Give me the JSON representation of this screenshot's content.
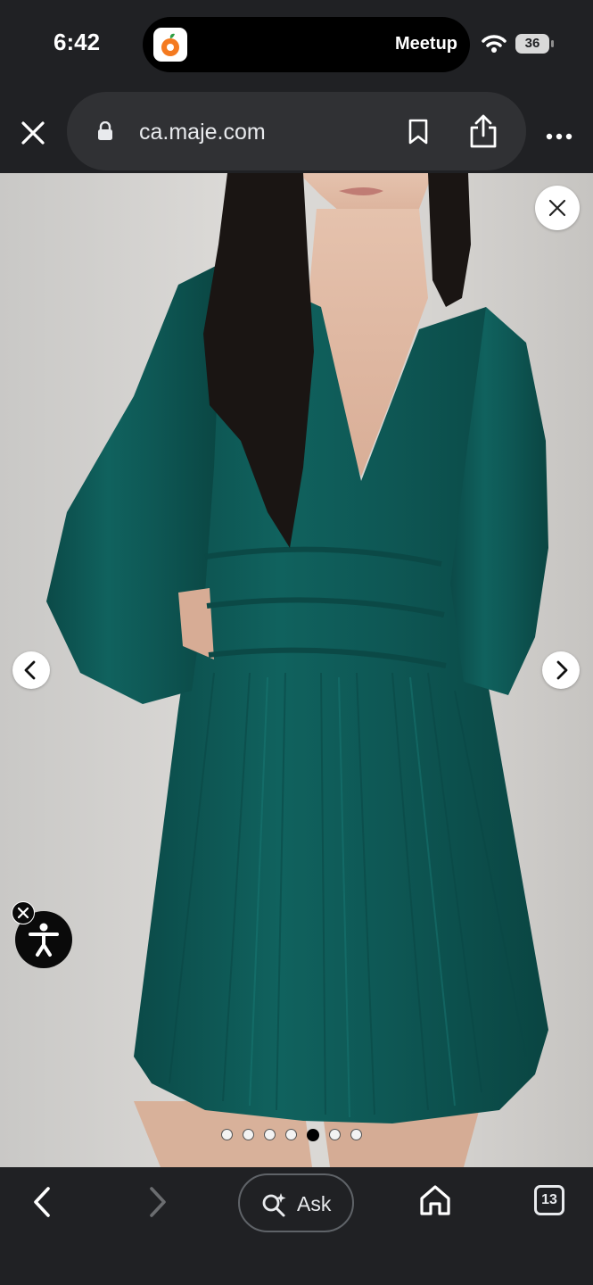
{
  "status_bar": {
    "time": "6:42",
    "island_label": "Meetup",
    "battery": "36"
  },
  "browser": {
    "url": "ca.maje.com",
    "icons": [
      "close-icon",
      "lock-icon",
      "bookmark-icon",
      "share-icon",
      "more-icon"
    ]
  },
  "gallery": {
    "dot_count": 7,
    "active_index": 4,
    "icons": [
      "close-icon",
      "chevron-left-icon",
      "chevron-right-icon",
      "accessibility-icon"
    ]
  },
  "bottom_bar": {
    "ask_label": "Ask",
    "tab_count": "13",
    "icons": [
      "back-icon",
      "forward-icon",
      "lens-sparkle-icon",
      "home-icon",
      "tabs-icon"
    ]
  },
  "colors": {
    "dress": "#0e5a57",
    "chrome": "#202124",
    "hair": "#1a1513"
  }
}
